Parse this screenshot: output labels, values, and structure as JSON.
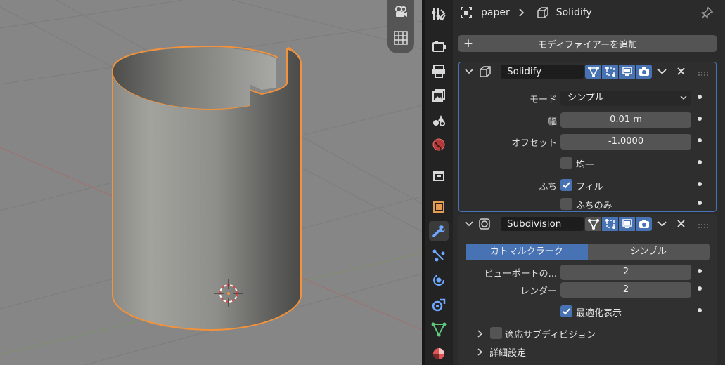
{
  "breadcrumb": {
    "object": "paper",
    "modifier": "Solidify"
  },
  "add_modifier": {
    "label": "モディファイアーを追加"
  },
  "colors": {
    "accent": "#4772b3",
    "selection_outline": "#f2923a"
  },
  "solidify": {
    "name": "Solidify",
    "icon": "solidify-modifier-icon",
    "mode_label": "モード",
    "mode_value": "シンプル",
    "width_label": "幅",
    "width_value": "0.01 m",
    "offset_label": "オフセット",
    "offset_value": "-1.0000",
    "even_label": "均一",
    "rim_label": "ふち",
    "fill_label": "フィル",
    "rim_only_label": "ふちのみ"
  },
  "subdivision": {
    "name": "Subdivision",
    "icon": "subdivision-modifier-icon",
    "tab_catmull": "カトマルクラーク",
    "tab_simple": "シンプル",
    "viewport_label": "ビューポートの...",
    "viewport_value": "2",
    "render_label": "レンダー",
    "render_value": "2",
    "optimal_label": "最適化表示",
    "adaptive_label": "適応サブディビジョン",
    "advanced_label": "詳細設定"
  }
}
